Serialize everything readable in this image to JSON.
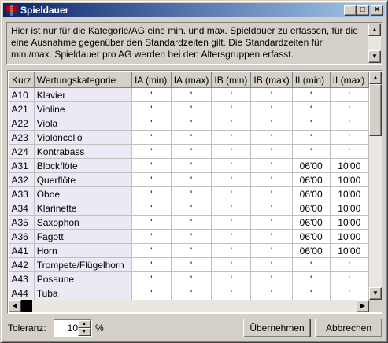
{
  "window": {
    "title": "Spieldauer",
    "minimize_glyph": "_",
    "maximize_glyph": "□",
    "close_glyph": "×"
  },
  "info_text": "Hier ist nur für die Kategorie/AG eine min. und max. Spieldauer zu erfassen, für die eine Ausnahme gegenüber den Standardzeiten gilt. Die Standardzeiten für min./max. Spieldauer pro AG werden bei den Altersgruppen erfasst.",
  "table": {
    "columns": [
      "Kurz",
      "Wertungskategorie",
      "IA (min)",
      "IA (max)",
      "IB (min)",
      "IB (max)",
      "II (min)",
      "II (max)"
    ],
    "rows": [
      [
        "A10",
        "Klavier",
        "'",
        "'",
        "'",
        "'",
        "'",
        "'"
      ],
      [
        "A21",
        "Violine",
        "'",
        "'",
        "'",
        "'",
        "'",
        "'"
      ],
      [
        "A22",
        "Viola",
        "'",
        "'",
        "'",
        "'",
        "'",
        "'"
      ],
      [
        "A23",
        "Violoncello",
        "'",
        "'",
        "'",
        "'",
        "'",
        "'"
      ],
      [
        "A24",
        "Kontrabass",
        "'",
        "'",
        "'",
        "'",
        "'",
        "'"
      ],
      [
        "A31",
        "Blockflöte",
        "'",
        "'",
        "'",
        "'",
        "06'00",
        "10'00"
      ],
      [
        "A32",
        "Querflöte",
        "'",
        "'",
        "'",
        "'",
        "06'00",
        "10'00"
      ],
      [
        "A33",
        "Oboe",
        "'",
        "'",
        "'",
        "'",
        "06'00",
        "10'00"
      ],
      [
        "A34",
        "Klarinette",
        "'",
        "'",
        "'",
        "'",
        "06'00",
        "10'00"
      ],
      [
        "A35",
        "Saxophon",
        "'",
        "'",
        "'",
        "'",
        "06'00",
        "10'00"
      ],
      [
        "A36",
        "Fagott",
        "'",
        "'",
        "'",
        "'",
        "06'00",
        "10'00"
      ],
      [
        "A41",
        "Horn",
        "'",
        "'",
        "'",
        "'",
        "06'00",
        "10'00"
      ],
      [
        "A42",
        "Trompete/Flügelhorn",
        "'",
        "'",
        "'",
        "'",
        "'",
        "'"
      ],
      [
        "A43",
        "Posaune",
        "'",
        "'",
        "'",
        "'",
        "'",
        "'"
      ],
      [
        "A44",
        "Tuba",
        "'",
        "'",
        "'",
        "'",
        "'",
        "'"
      ]
    ]
  },
  "toleranz": {
    "label": "Toleranz:",
    "value": "10",
    "unit": "%"
  },
  "buttons": {
    "ok": "Übernehmen",
    "cancel": "Abbrechen"
  },
  "colors": {
    "title_bar_start": "#0a246a",
    "title_bar_end": "#a6caf0",
    "face": "#d4d0c8",
    "key_column_bg": "#ece9f4"
  }
}
